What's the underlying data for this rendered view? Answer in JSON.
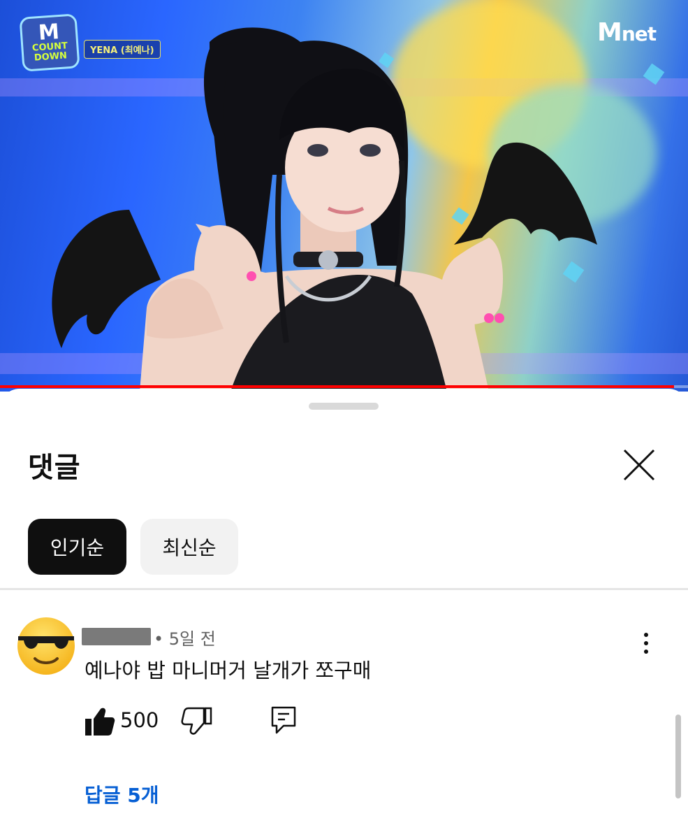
{
  "video": {
    "show_logo": "M COUNT DOWN",
    "show_logo_big": "M",
    "show_logo_small": "COUNT\nDOWN",
    "artist_tag": "YENA (최예나)",
    "channel_logo_m": "M",
    "channel_logo_text": "net",
    "progress_fraction": 0.98,
    "progress_color": "#ff0000"
  },
  "comments_panel": {
    "title": "댓글",
    "close_icon": "close-icon",
    "sort_chips": [
      {
        "label": "인기순",
        "selected": true
      },
      {
        "label": "최신순",
        "selected": false
      }
    ],
    "comment": {
      "avatar_icon": "sunglasses-emoji-icon",
      "author": "",
      "time": "• 5일 전",
      "text": "예나야 밥 마니머거 날개가 쪼구매",
      "likes": "500",
      "like_icon": "thumbs-up-filled-icon",
      "dislike_icon": "thumbs-down-icon",
      "reply_icon": "reply-comment-icon",
      "menu_icon": "more-vert-icon",
      "replies_label": "답글 5개"
    }
  },
  "colors": {
    "accent_link": "#065fd4",
    "chip_active_bg": "#0f0f0f",
    "chip_inactive_bg": "#f2f2f2"
  }
}
